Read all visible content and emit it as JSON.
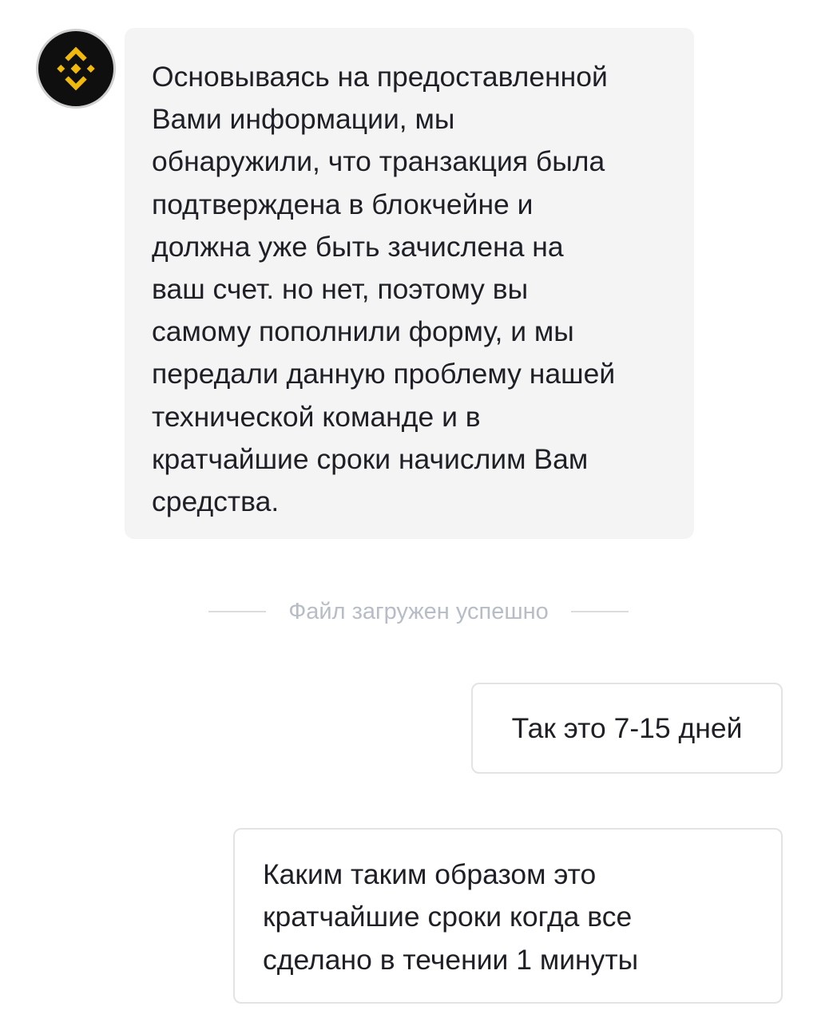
{
  "chat": {
    "agent": {
      "avatar_icon": "binance-logo-icon",
      "avatar_colors": {
        "background": "#0f0f10",
        "logo": "#f0b90b"
      },
      "message": "Основываясь на предоставленной\nВами информации, мы\nобнаружили, что транзакция была\nподтверждена в блокчейне и\nдолжна уже быть зачислена на\nваш счет. но нет, поэтому вы\nсамому пополнили форму, и мы\nпередали данную проблему нашей\nтехнической команде и в\nкратчайшие сроки начислим Вам\nсредства."
    },
    "system_note": "Файл загружен успешно",
    "user_messages": [
      {
        "text": "Так это 7-15 дней"
      },
      {
        "text": "Каким таким образом это\nкратчайшие сроки когда все\nсделано в течении 1 минуты"
      }
    ]
  }
}
